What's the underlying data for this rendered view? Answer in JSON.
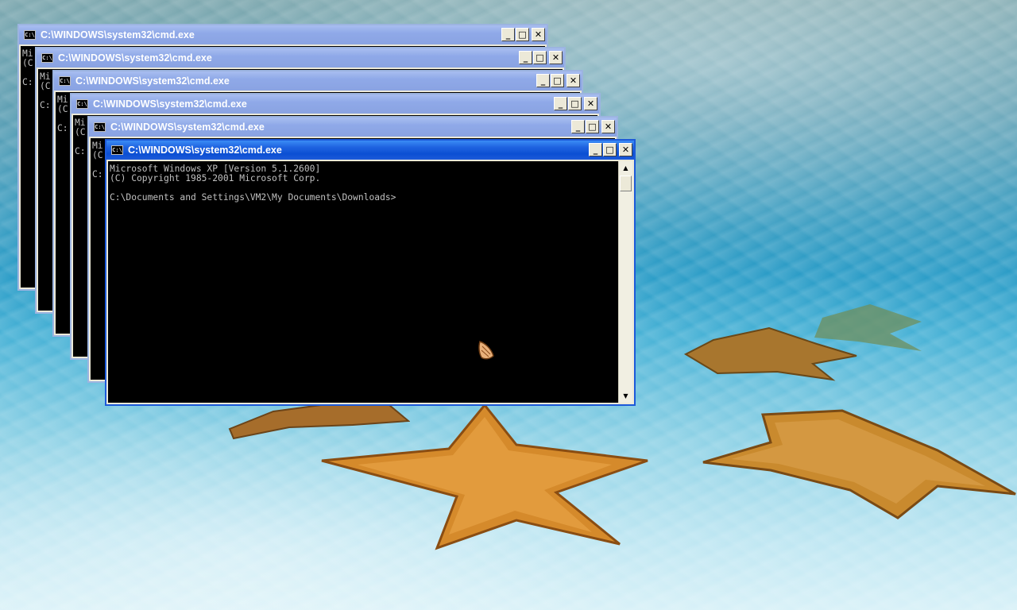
{
  "desktop": {
    "wallpaper": "underwater starfish",
    "colors": {
      "water_top": "#5e9fb3",
      "water_mid": "#2a9cc7",
      "water_bottom": "#d8f1f8",
      "starfish": "#d98b2a"
    }
  },
  "windows": [
    {
      "title": "C:\\WINDOWS\\system32\\cmd.exe",
      "peek": "Mi\n(C\n\nC:"
    },
    {
      "title": "C:\\WINDOWS\\system32\\cmd.exe",
      "peek": "Mi\n(C\n\nC:"
    },
    {
      "title": "C:\\WINDOWS\\system32\\cmd.exe",
      "peek": "Mi\n(C\n\nC:"
    },
    {
      "title": "C:\\WINDOWS\\system32\\cmd.exe",
      "peek": "Mi\n(C\n\nC:"
    },
    {
      "title": "C:\\WINDOWS\\system32\\cmd.exe",
      "peek": "Mi\n(C\n\nC:"
    },
    {
      "title": "C:\\WINDOWS\\system32\\cmd.exe",
      "active": true,
      "console_lines": [
        "Microsoft Windows XP [Version 5.1.2600]",
        "(C) Copyright 1985-2001 Microsoft Corp.",
        "",
        "C:\\Documents and Settings\\VM2\\My Documents\\Downloads>"
      ]
    }
  ],
  "icons": {
    "app": "cmd-icon",
    "minimize": "minimize-icon",
    "maximize": "maximize-icon",
    "close": "close-icon",
    "cursor": "shell-cursor-icon"
  },
  "glyphs": {
    "app": "C:\\",
    "minimize": "_",
    "maximize": "□",
    "close": "✕",
    "up": "▲",
    "down": "▼"
  }
}
